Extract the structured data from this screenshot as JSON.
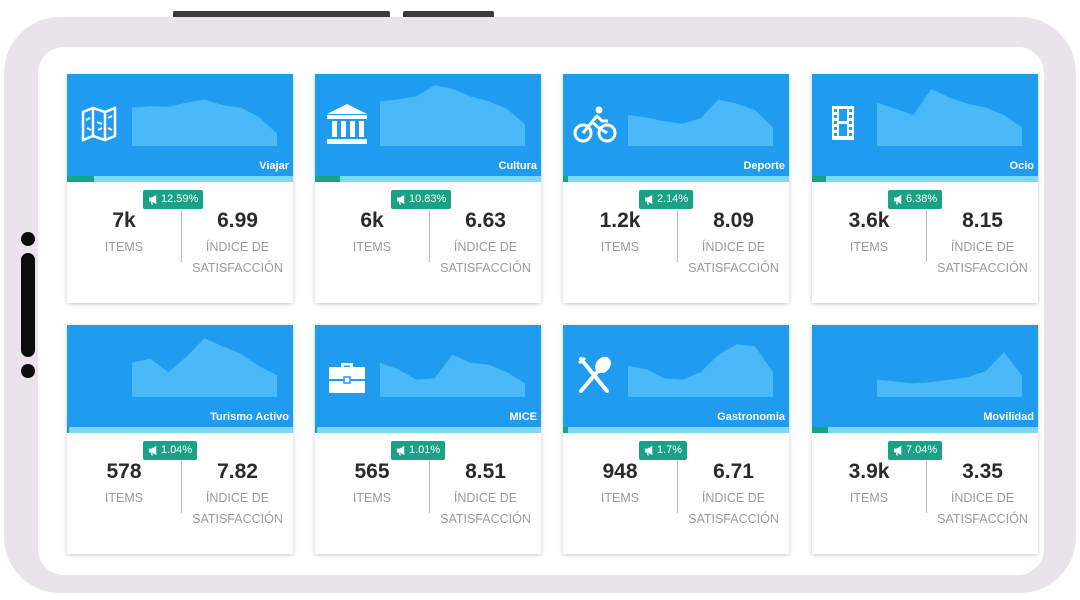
{
  "colors": {
    "header": "#1f9bef",
    "sparkline": "#4fbdf8",
    "progress_track": "#7fd6f7",
    "accent": "#1aa287",
    "device_frame": "#ebe3eb"
  },
  "labels": {
    "items": "ITEMS",
    "satisfaction_line1": "ÍNDICE DE",
    "satisfaction_line2": "SATISFACCIÓN"
  },
  "cards": [
    {
      "category": "Viajar",
      "icon": "map-icon",
      "badge": "12.59%",
      "progress": 0.12,
      "items": "7k",
      "satisfaction": "6.99",
      "trend": [
        0.62,
        0.64,
        0.63,
        0.7,
        0.75,
        0.66,
        0.62,
        0.47,
        0.2
      ]
    },
    {
      "category": "Cultura",
      "icon": "museum-icon",
      "badge": "10.83%",
      "progress": 0.11,
      "items": "6k",
      "satisfaction": "6.63",
      "trend": [
        0.72,
        0.75,
        0.8,
        0.98,
        0.92,
        0.8,
        0.72,
        0.6,
        0.35
      ]
    },
    {
      "category": "Deporte",
      "icon": "bicycle-icon",
      "badge": "2.14%",
      "progress": 0.02,
      "items": "1.2k",
      "satisfaction": "8.09",
      "trend": [
        0.5,
        0.46,
        0.4,
        0.36,
        0.45,
        0.75,
        0.68,
        0.58,
        0.3
      ]
    },
    {
      "category": "Ocio",
      "icon": "film-icon",
      "badge": "6.38%",
      "progress": 0.06,
      "items": "3.6k",
      "satisfaction": "8.15",
      "trend": [
        0.7,
        0.6,
        0.5,
        0.92,
        0.78,
        0.68,
        0.62,
        0.5,
        0.3
      ]
    },
    {
      "category": "Turismo Activo",
      "icon": "",
      "badge": "1.04%",
      "progress": 0.01,
      "items": "578",
      "satisfaction": "7.82",
      "trend": [
        0.55,
        0.62,
        0.4,
        0.65,
        0.95,
        0.82,
        0.7,
        0.5,
        0.35
      ]
    },
    {
      "category": "MICE",
      "icon": "briefcase-icon",
      "badge": "1.01%",
      "progress": 0.01,
      "items": "565",
      "satisfaction": "8.51",
      "trend": [
        0.55,
        0.45,
        0.28,
        0.3,
        0.68,
        0.55,
        0.52,
        0.4,
        0.22
      ]
    },
    {
      "category": "Gastronomia",
      "icon": "cutlery-icon",
      "badge": "1.7%",
      "progress": 0.02,
      "items": "948",
      "satisfaction": "6.71",
      "trend": [
        0.5,
        0.45,
        0.3,
        0.28,
        0.4,
        0.68,
        0.85,
        0.82,
        0.4
      ]
    },
    {
      "category": "Movilidad",
      "icon": "",
      "badge": "7.04%",
      "progress": 0.07,
      "items": "3.9k",
      "satisfaction": "3.35",
      "trend": [
        0.28,
        0.25,
        0.22,
        0.24,
        0.28,
        0.32,
        0.42,
        0.72,
        0.35
      ]
    }
  ]
}
